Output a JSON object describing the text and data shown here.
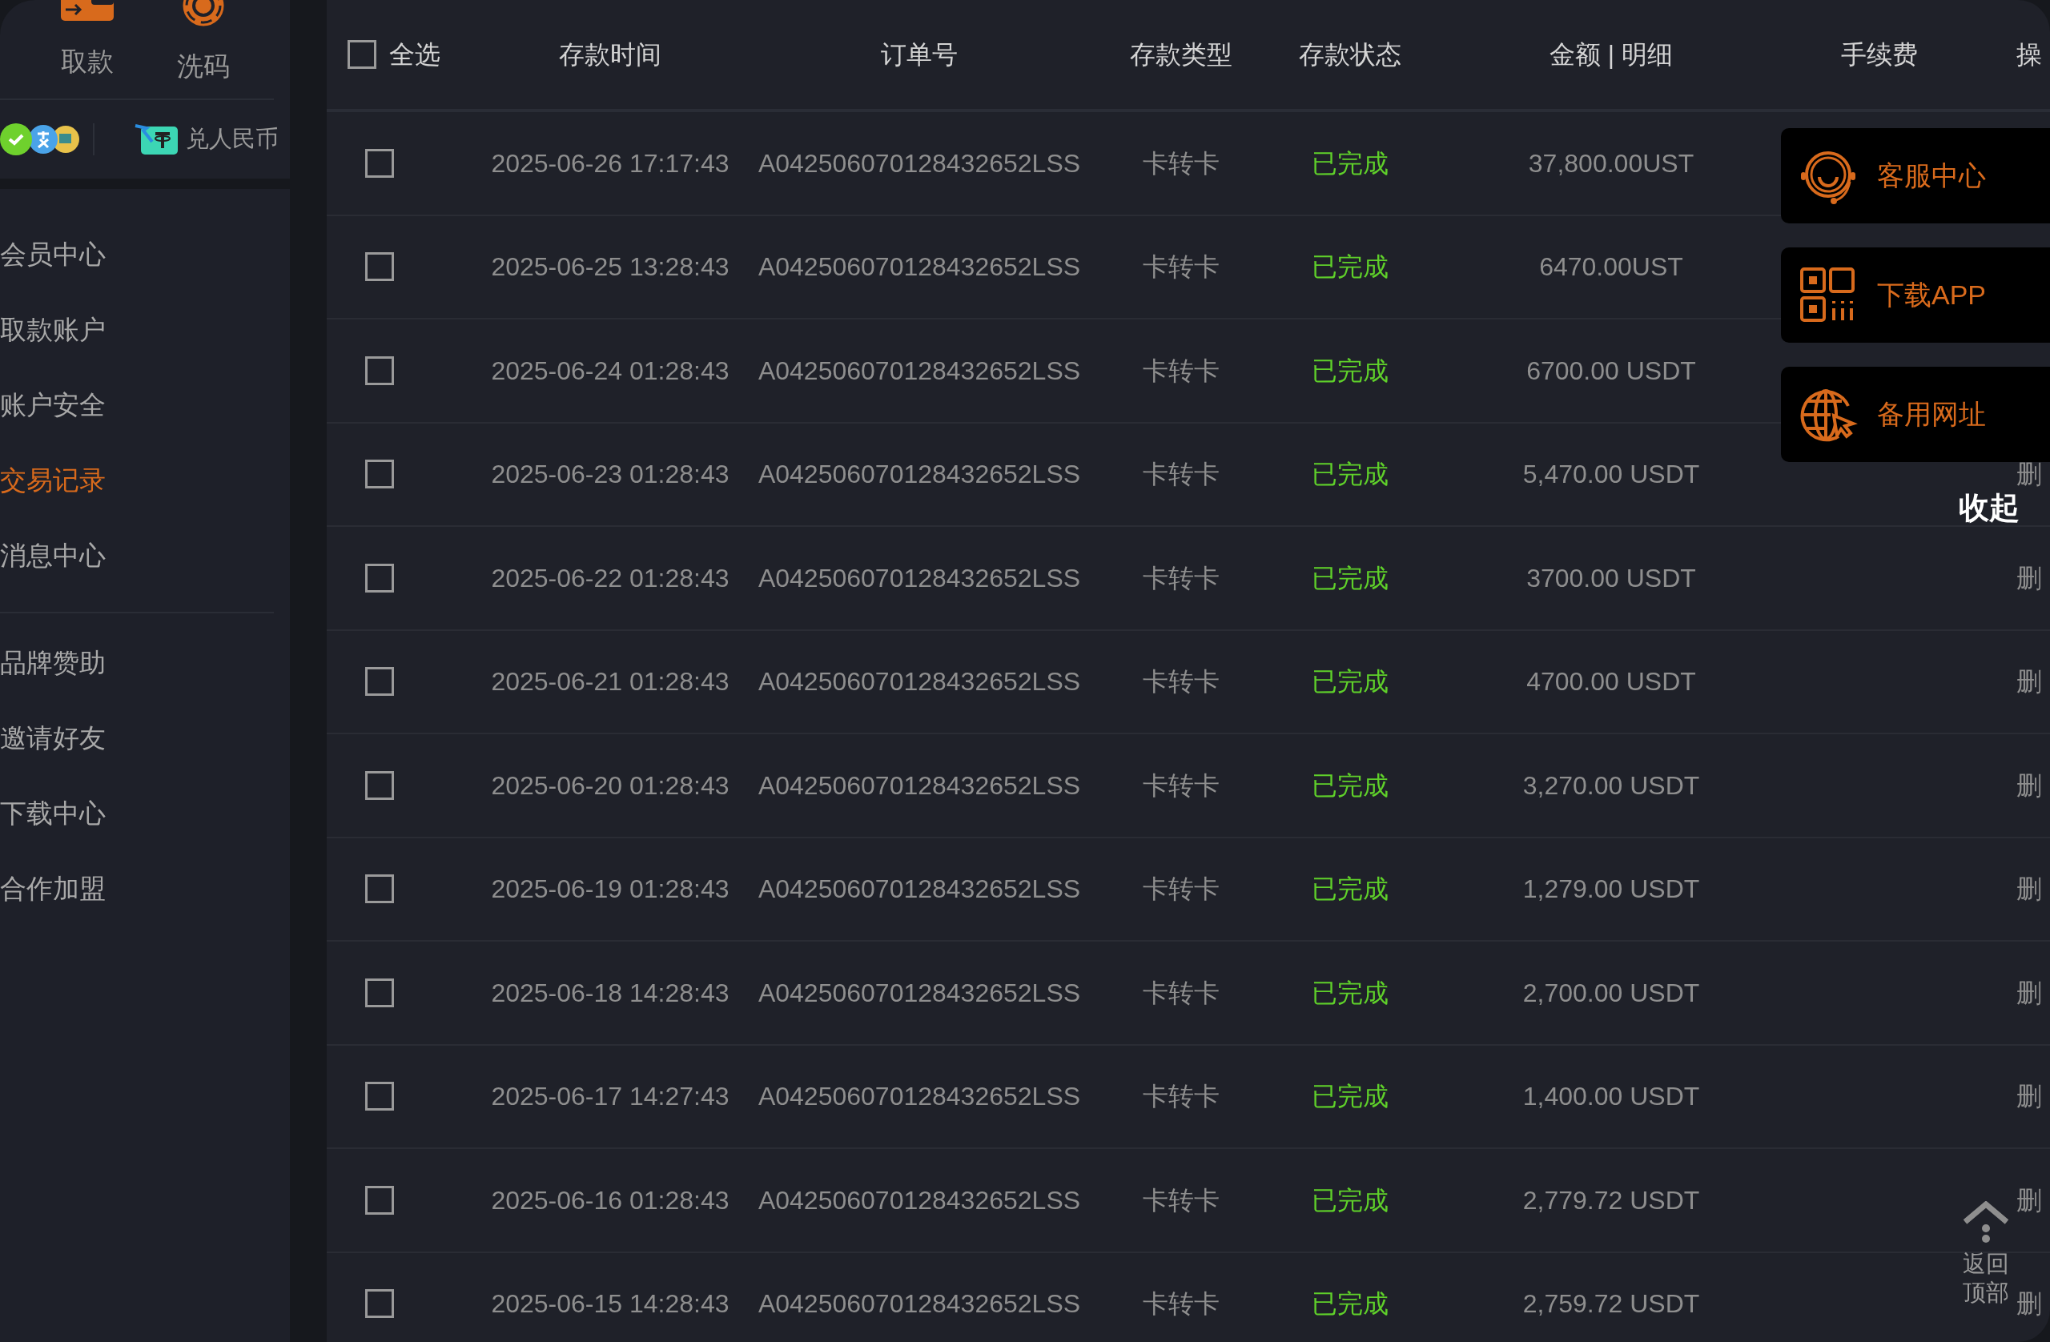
{
  "sidebar": {
    "quick_actions": [
      {
        "label": "取款",
        "kind": "wallet"
      },
      {
        "label": "洗码",
        "kind": "chip"
      }
    ],
    "exchange": {
      "label": "兑人民币"
    },
    "menu_groups": [
      [
        {
          "label": "会员中心",
          "selected": false
        },
        {
          "label": "取款账户",
          "selected": false
        },
        {
          "label": "账户安全",
          "selected": false
        },
        {
          "label": "交易记录",
          "selected": true
        },
        {
          "label": "消息中心",
          "selected": false
        }
      ],
      [
        {
          "label": "品牌赞助",
          "selected": false
        },
        {
          "label": "邀请好友",
          "selected": false
        },
        {
          "label": "下载中心",
          "selected": false
        },
        {
          "label": "合作加盟",
          "selected": false
        }
      ]
    ]
  },
  "table": {
    "select_all": {
      "label": "全选",
      "checked": false
    },
    "columns": [
      "存款时间",
      "订单号",
      "存款类型",
      "存款状态",
      "金额 | 明细",
      "手续费",
      "操"
    ],
    "rows": [
      {
        "checked": false,
        "time": "2025-06-26 17:17:43",
        "order": "A042506070128432652LSS",
        "type": "卡转卡",
        "status": "已完成",
        "amount": "37,800.00UST"
      },
      {
        "checked": false,
        "time": "2025-06-25 13:28:43",
        "order": "A042506070128432652LSS",
        "type": "卡转卡",
        "status": "已完成",
        "amount": "6470.00UST"
      },
      {
        "checked": false,
        "time": "2025-06-24 01:28:43",
        "order": "A042506070128432652LSS",
        "type": "卡转卡",
        "status": "已完成",
        "amount": "6700.00 USDT"
      },
      {
        "checked": false,
        "time": "2025-06-23 01:28:43",
        "order": "A042506070128432652LSS",
        "type": "卡转卡",
        "status": "已完成",
        "amount": "5,470.00 USDT",
        "action": "删"
      },
      {
        "checked": false,
        "time": "2025-06-22 01:28:43",
        "order": "A042506070128432652LSS",
        "type": "卡转卡",
        "status": "已完成",
        "amount": "3700.00 USDT",
        "action": "删"
      },
      {
        "checked": false,
        "time": "2025-06-21 01:28:43",
        "order": "A042506070128432652LSS",
        "type": "卡转卡",
        "status": "已完成",
        "amount": "4700.00 USDT",
        "action": "删"
      },
      {
        "checked": false,
        "time": "2025-06-20 01:28:43",
        "order": "A042506070128432652LSS",
        "type": "卡转卡",
        "status": "已完成",
        "amount": "3,270.00 USDT",
        "action": "删"
      },
      {
        "checked": false,
        "time": "2025-06-19 01:28:43",
        "order": "A042506070128432652LSS",
        "type": "卡转卡",
        "status": "已完成",
        "amount": "1,279.00 USDT",
        "action": "删"
      },
      {
        "checked": false,
        "time": "2025-06-18 14:28:43",
        "order": "A042506070128432652LSS",
        "type": "卡转卡",
        "status": "已完成",
        "amount": "2,700.00 USDT",
        "action": "删"
      },
      {
        "checked": false,
        "time": "2025-06-17 14:27:43",
        "order": "A042506070128432652LSS",
        "type": "卡转卡",
        "status": "已完成",
        "amount": "1,400.00 USDT",
        "action": "删"
      },
      {
        "checked": false,
        "time": "2025-06-16 01:28:43",
        "order": "A042506070128432652LSS",
        "type": "卡转卡",
        "status": "已完成",
        "amount": "2,779.72 USDT",
        "action": "删"
      },
      {
        "checked": false,
        "time": "2025-06-15 14:28:43",
        "order": "A042506070128432652LSS",
        "type": "卡转卡",
        "status": "已完成",
        "amount": "2,759.72 USDT",
        "action": "删"
      }
    ]
  },
  "float_panel": {
    "items": [
      {
        "label": "客服中心",
        "kind": "headset"
      },
      {
        "label": "下载APP",
        "kind": "qr"
      },
      {
        "label": "备用网址",
        "kind": "globe"
      }
    ],
    "collapse": "收起",
    "back_to_top": "返回顶部"
  }
}
